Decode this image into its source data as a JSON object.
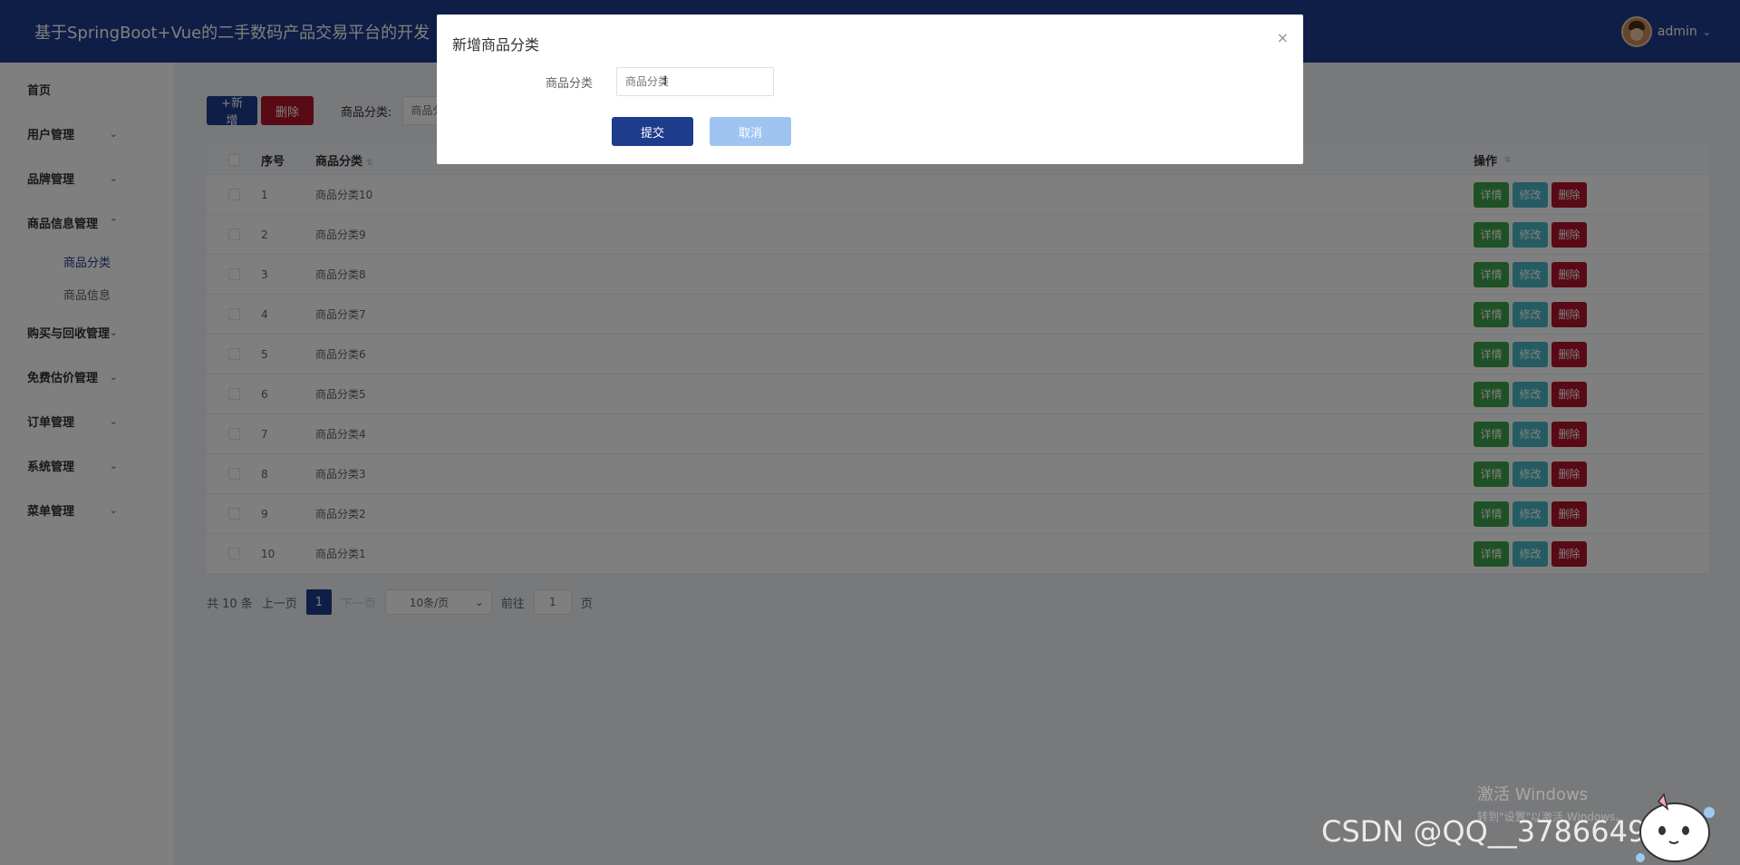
{
  "header": {
    "title": "基于SpringBoot+Vue的二手数码产品交易平台的开发",
    "user_name": "admin"
  },
  "sidebar": {
    "items": [
      {
        "label": "首页"
      },
      {
        "label": "用户管理"
      },
      {
        "label": "品牌管理"
      },
      {
        "label": "商品信息管理",
        "sub": [
          "商品分类",
          "商品信息"
        ]
      },
      {
        "label": "购买与回收管理"
      },
      {
        "label": "免费估价管理"
      },
      {
        "label": "订单管理"
      },
      {
        "label": "系统管理"
      },
      {
        "label": "菜单管理"
      }
    ],
    "active_sub": "商品分类"
  },
  "toolbar": {
    "add_label": "+新增",
    "delete_label": "删除",
    "filter_label": "商品分类:",
    "filter_placeholder": "商品分"
  },
  "table": {
    "headers": {
      "index": "序号",
      "category": "商品分类",
      "operations": "操作"
    },
    "rows": [
      {
        "index": "1",
        "category": "商品分类10"
      },
      {
        "index": "2",
        "category": "商品分类9"
      },
      {
        "index": "3",
        "category": "商品分类8"
      },
      {
        "index": "4",
        "category": "商品分类7"
      },
      {
        "index": "5",
        "category": "商品分类6"
      },
      {
        "index": "6",
        "category": "商品分类5"
      },
      {
        "index": "7",
        "category": "商品分类4"
      },
      {
        "index": "8",
        "category": "商品分类3"
      },
      {
        "index": "9",
        "category": "商品分类2"
      },
      {
        "index": "10",
        "category": "商品分类1"
      }
    ],
    "op_labels": {
      "detail": "详情",
      "edit": "修改",
      "delete": "删除"
    }
  },
  "pagination": {
    "total": "共 10 条",
    "prev": "上一页",
    "current": "1",
    "next": "下一页",
    "page_size": "10条/页",
    "goto_label": "前往",
    "goto_value": "1",
    "page_suffix": "页"
  },
  "dialog": {
    "title": "新增商品分类",
    "field_label": "商品分类",
    "field_placeholder": "商品分类",
    "submit_label": "提交",
    "cancel_label": "取消"
  },
  "watermarks": {
    "windows_line1": "激活 Windows",
    "windows_line2": "转到\"设置\"以激活 Windows。",
    "csdn": "CSDN @QQ__3786649731"
  },
  "colors": {
    "primary": "#1e3c8c",
    "danger": "#b0142a",
    "success": "#3fa34d",
    "info": "#4ab8c6"
  }
}
